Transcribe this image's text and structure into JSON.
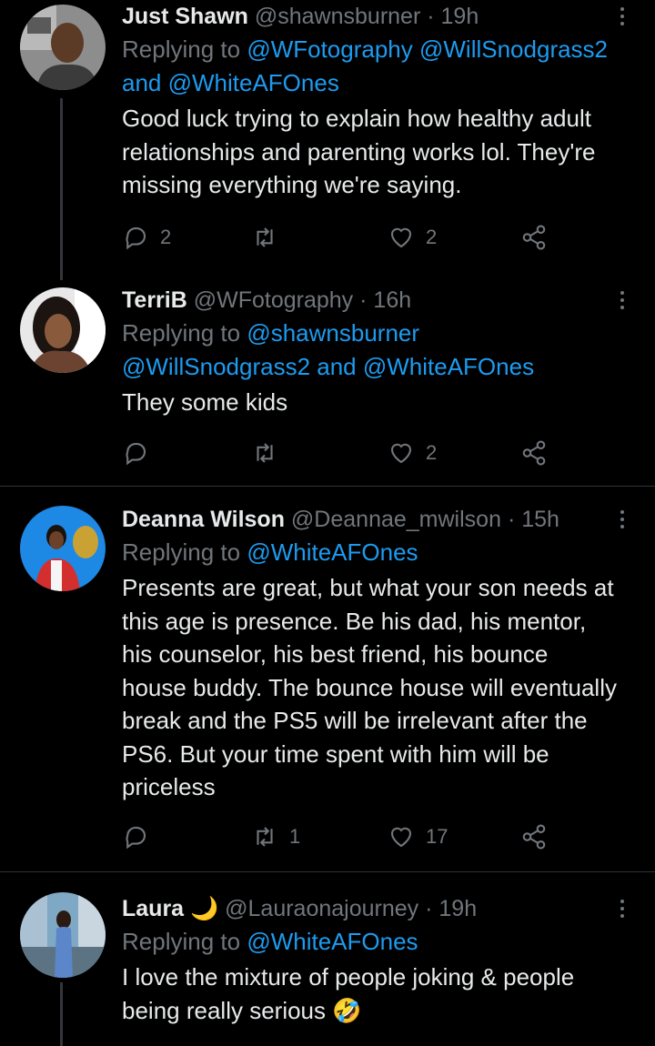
{
  "tweets": [
    {
      "name": "Just Shawn",
      "handle": "@shawnsburner",
      "time": "· 19h",
      "reply_prefix": "Replying to ",
      "reply_line1": "@WFotography @WillSnodgrass2",
      "reply_line2_and": "and ",
      "reply_line2_mention": "@WhiteAFOnes",
      "text": "Good luck trying to explain how healthy adult relationships and parenting works lol. They're missing everything we're saying.",
      "replies": "2",
      "retweets": "",
      "likes": "2"
    },
    {
      "name": "TerriB",
      "handle": "@WFotography",
      "time": "· 16h",
      "reply_prefix": "Replying to ",
      "reply_line1": "@shawnsburner",
      "reply_line2_mention_a": "@WillSnodgrass2",
      "reply_line2_and": " and ",
      "reply_line2_mention_b": "@WhiteAFOnes",
      "text": "They some kids",
      "replies": "",
      "retweets": "",
      "likes": "2"
    },
    {
      "name": "Deanna Wilson",
      "handle": "@Deannae_mwilson",
      "time": "· 15h",
      "reply_prefix": "Replying to ",
      "reply_mention": "@WhiteAFOnes",
      "text": "Presents are great, but what your son needs at this age is presence. Be his dad, his mentor, his counselor, his best friend, his bounce house buddy. The bounce house will eventually break and the PS5 will be irrelevant after the PS6. But your time spent with him will be priceless",
      "replies": "",
      "retweets": "1",
      "likes": "17"
    },
    {
      "name": "Laura",
      "name_emoji": "🌙",
      "handle": "@Lauraonajourney",
      "time": "· 19h",
      "reply_prefix": "Replying to ",
      "reply_mention": "@WhiteAFOnes",
      "text": "I love the mixture of people joking & people being really serious",
      "text_emoji": "🤣"
    }
  ],
  "colors": {
    "background": "#000000",
    "text": "#e7e9ea",
    "muted": "#71767b",
    "link": "#1d9bf0",
    "divider": "#2f3336"
  },
  "icons": [
    "reply-icon",
    "retweet-icon",
    "like-icon",
    "share-icon",
    "more-icon"
  ]
}
